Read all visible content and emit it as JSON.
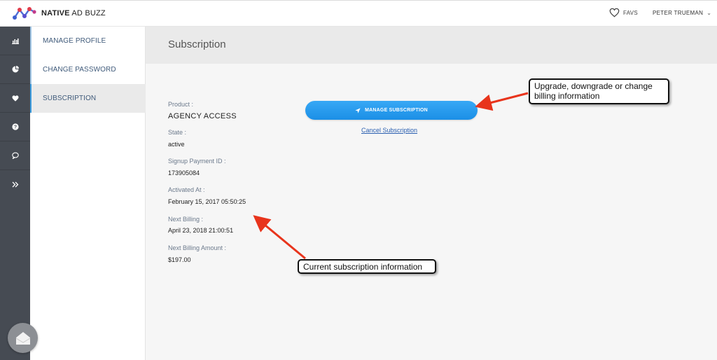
{
  "brand": {
    "name_bold": "NATIVE",
    "name_rest": " AD BUZZ"
  },
  "header": {
    "favs_label": "FAVS",
    "user_name": "PETER TRUEMAN"
  },
  "rail": {
    "items": [
      {
        "icon": "bar-chart-icon"
      },
      {
        "icon": "pie-chart-icon"
      },
      {
        "icon": "heart-icon"
      },
      {
        "icon": "help-icon"
      },
      {
        "icon": "chat-icon"
      },
      {
        "icon": "expand-icon"
      }
    ]
  },
  "submenu": {
    "items": [
      {
        "label": "MANAGE PROFILE"
      },
      {
        "label": "CHANGE PASSWORD"
      },
      {
        "label": "SUBSCRIPTION"
      }
    ]
  },
  "page": {
    "title": "Subscription"
  },
  "subscription": {
    "fields": [
      {
        "label": "Product :",
        "value": "AGENCY ACCESS"
      },
      {
        "label": "State :",
        "value": "active"
      },
      {
        "label": "Signup Payment ID :",
        "value": "173905084"
      },
      {
        "label": "Activated At :",
        "value": "February 15, 2017 05:50:25"
      },
      {
        "label": "Next Billing :",
        "value": "April 23, 2018 21:00:51"
      },
      {
        "label": "Next Billing Amount :",
        "value": "$197.00"
      }
    ],
    "manage_label": "MANAGE SUBSCRIPTION",
    "cancel_label": "Cancel Subscription"
  },
  "annotations": {
    "upgrade_note_line1": "Upgrade, downgrade or change",
    "upgrade_note_line2": "billing information",
    "current_note": "Current subscription information"
  },
  "colors": {
    "accent": "#1b8fe6",
    "rail": "#464b53",
    "arrow": "#e8341c"
  }
}
